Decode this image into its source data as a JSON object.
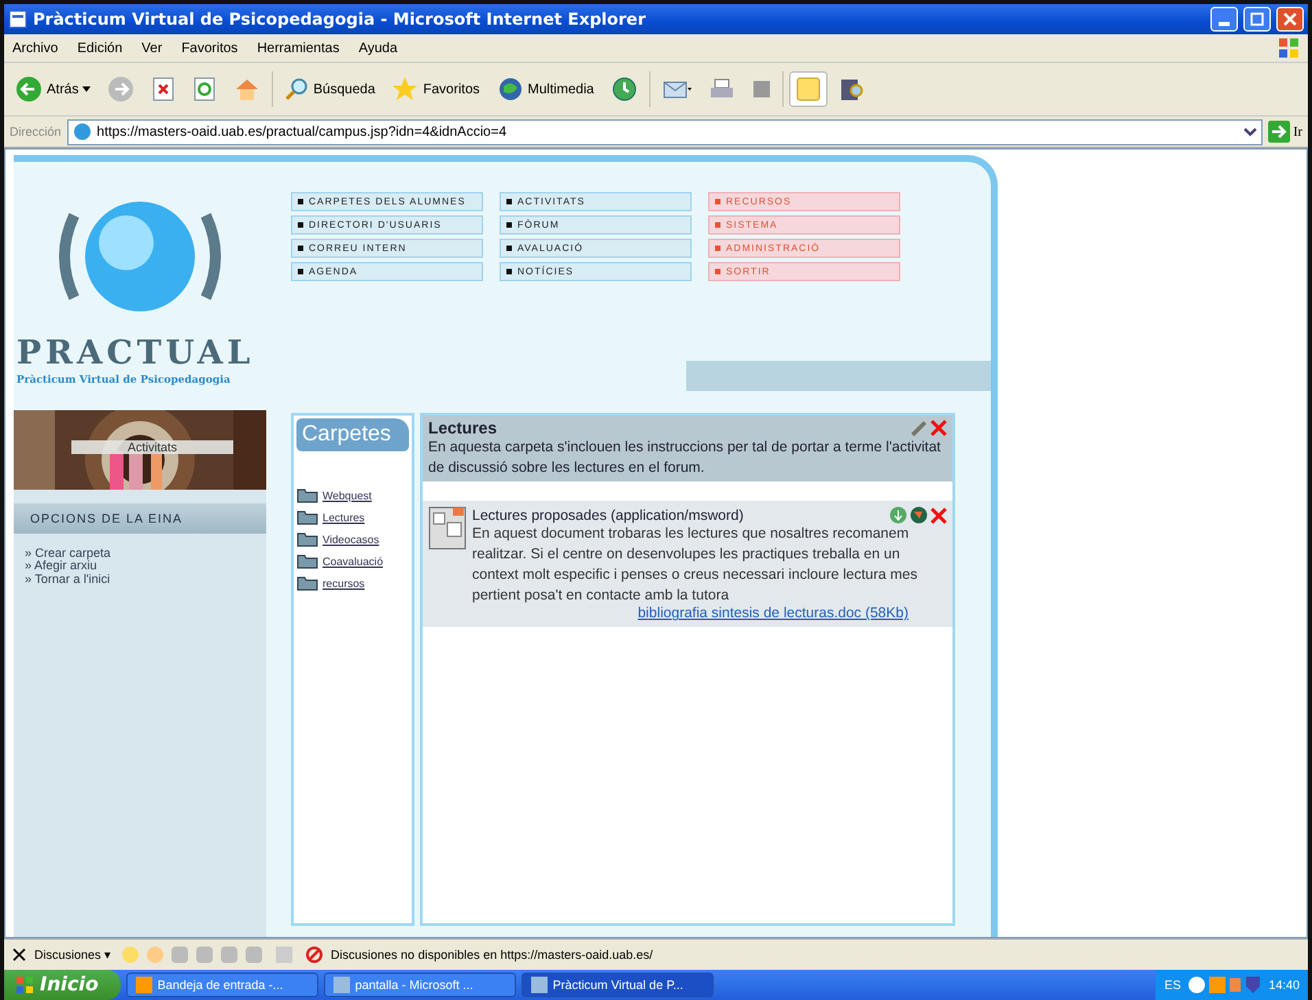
{
  "window": {
    "title": "Pràcticum Virtual de Psicopedagogia - Microsoft Internet Explorer"
  },
  "menu": [
    "Archivo",
    "Edición",
    "Ver",
    "Favoritos",
    "Herramientas",
    "Ayuda"
  ],
  "toolbar": {
    "back": "Atrás",
    "search": "Búsqueda",
    "favorites": "Favoritos",
    "media": "Multimedia"
  },
  "address": {
    "label": "Dirección",
    "value": "https://masters-oaid.uab.es/practual/campus.jsp?idn=4&idnAccio=4",
    "go": "Ir"
  },
  "site": {
    "logo": "PRACTUAL",
    "subtitle": "Pràcticum Virtual de Psicopedagogia",
    "banner": "Activitats"
  },
  "nav": [
    {
      "label": "CARPETES DELS ALUMNES",
      "kind": "user"
    },
    {
      "label": "ACTIVITATS",
      "kind": "user"
    },
    {
      "label": "RECURSOS",
      "kind": "admin"
    },
    {
      "label": "DIRECTORI D'USUARIS",
      "kind": "user"
    },
    {
      "label": "FÒRUM",
      "kind": "user"
    },
    {
      "label": "SISTEMA",
      "kind": "admin"
    },
    {
      "label": "CORREU INTERN",
      "kind": "user"
    },
    {
      "label": "AVALUACIÓ",
      "kind": "user"
    },
    {
      "label": "ADMINISTRACIÓ",
      "kind": "admin"
    },
    {
      "label": "AGENDA",
      "kind": "user"
    },
    {
      "label": "NOTÍCIES",
      "kind": "user"
    },
    {
      "label": "SORTIR",
      "kind": "admin"
    }
  ],
  "tool_options": {
    "title": "OPCIONS DE LA EINA",
    "links": [
      "» Crear carpeta",
      "» Afegir arxiu",
      "» Tornar a l'inici"
    ]
  },
  "folders": {
    "title": "Carpetes",
    "items": [
      "Webquest",
      "Lectures",
      "Videocasos",
      "Coavaluació",
      "recursos"
    ]
  },
  "folder": {
    "title": "Lectures",
    "description": "En aquesta carpeta s'inclouen les instruccions per tal de portar a terme l'activitat de discussió sobre les lectures en el forum.",
    "file": {
      "title": "Lectures proposades (application/msword)",
      "description": "En aquest document trobaras les lectures que nosaltres recomanem realitzar. Si el centre on desenvolupes les practiques treballa en un context molt especific i penses o creus necessari incloure lectura mes pertient posa't en contacte amb la tutora",
      "link": "bibliografia sintesis de lecturas.doc (58Kb)"
    }
  },
  "discussions": {
    "button": "Discusiones ▾",
    "message": "Discusiones no disponibles en https://masters-oaid.uab.es/"
  },
  "taskbar": {
    "start": "Inicio",
    "tasks": [
      {
        "label": "Bandeja de entrada -...",
        "selected": false
      },
      {
        "label": "pantalla - Microsoft ...",
        "selected": false
      },
      {
        "label": "Pràcticum Virtual de P...",
        "selected": true
      }
    ],
    "lang": "ES",
    "clock": "14:40"
  }
}
